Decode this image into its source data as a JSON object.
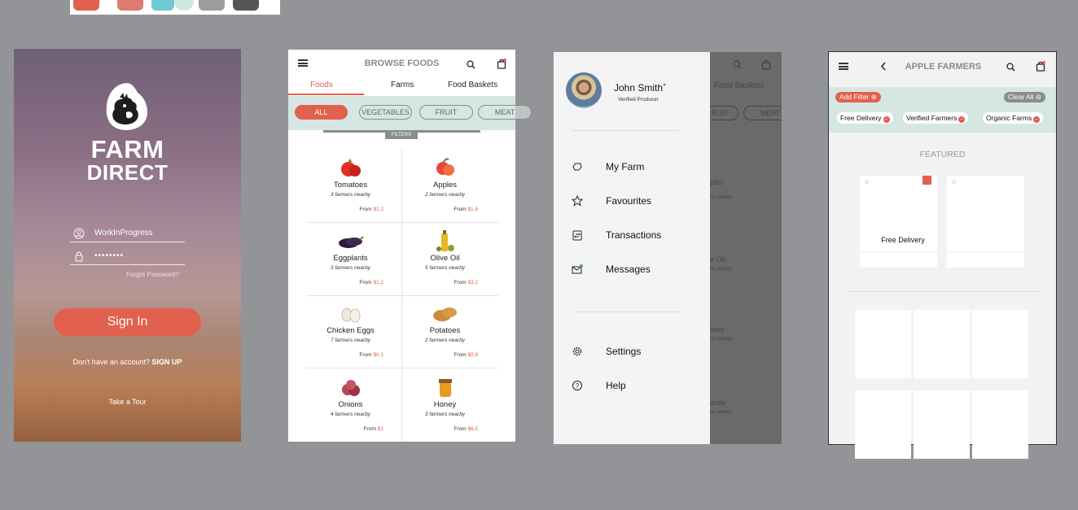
{
  "palette": {
    "colors": [
      "#e2604e",
      "#dd7b70",
      "#6fcad3",
      "#cde7e1",
      "#9c9c9c",
      "#565656"
    ]
  },
  "login": {
    "brand_line1": "FARM",
    "brand_line2": "DIRECT",
    "username_value": "WorkInProgress",
    "password_value": "••••••••",
    "forgot_label": "Forgot Password?",
    "signin_label": "Sign In",
    "no_account_text": "Don't have an account?",
    "signup_label": "SIGN UP",
    "tour_label": "Take a Tour"
  },
  "browse": {
    "title": "BROWSE FOODS",
    "cart_count": "",
    "tabs": [
      {
        "label": "Foods"
      },
      {
        "label": "Farms"
      },
      {
        "label": "Food Baskets"
      }
    ],
    "filters": [
      {
        "label": "ALL"
      },
      {
        "label": "VEGETABLES"
      },
      {
        "label": "FRUIT"
      },
      {
        "label": "MEAT"
      }
    ],
    "filters_label": "FILTERS",
    "from_label": "From",
    "foods": [
      {
        "name": "Tomatoes",
        "icon": "tomato-icon",
        "nearby": "3 farmers nearby",
        "price": "$1.2"
      },
      {
        "name": "Apples",
        "icon": "apple-icon",
        "nearby": "2 farmers nearby",
        "price": "$1.6"
      },
      {
        "name": "Eggplants",
        "icon": "eggplant-icon",
        "nearby": "3 farmers nearby",
        "price": "$1.2"
      },
      {
        "name": "Olive Oil",
        "icon": "olive-oil-icon",
        "nearby": "5 farmers nearby",
        "price": "$3.2"
      },
      {
        "name": "Chicken Eggs",
        "icon": "egg-icon",
        "nearby": "7 farmers nearby",
        "price": "$0.1"
      },
      {
        "name": "Potatoes",
        "icon": "potato-icon",
        "nearby": "2 farmers nearby",
        "price": "$0.9"
      },
      {
        "name": "Onions",
        "icon": "onion-icon",
        "nearby": "4 farmers nearby",
        "price": "$1"
      },
      {
        "name": "Honey",
        "icon": "honey-icon",
        "nearby": "3 farmers nearby",
        "price": "$6.5"
      }
    ]
  },
  "menu": {
    "user_name": "John Smith",
    "user_role": "Verified Producer",
    "items": [
      {
        "label": "My Farm",
        "icon": "farm-icon"
      },
      {
        "label": "Favourites",
        "icon": "star-icon"
      },
      {
        "label": "Transactions",
        "icon": "transactions-icon"
      },
      {
        "label": "Messages",
        "icon": "messages-icon"
      }
    ],
    "bottom_items": [
      {
        "label": "Settings",
        "icon": "gear-icon"
      },
      {
        "label": "Help",
        "icon": "help-icon"
      }
    ],
    "behind": {
      "tab": "Food Baskets",
      "filters": [
        "RUIT",
        "MEAT"
      ],
      "names": [
        "ples",
        "e Oil",
        "toes",
        "oney"
      ],
      "nearby": "rs nearby"
    }
  },
  "apple": {
    "title": "APPLE FARMERS",
    "add_filter_label": "Add Filter",
    "clear_all_label": "Clear All",
    "chips": [
      {
        "label": "Free Delivery"
      },
      {
        "label": "Verified Farmers"
      },
      {
        "label": "Organic Farms"
      }
    ],
    "featured_label": "FEATURED",
    "featured_cards": [
      {
        "label": "Free Delivery",
        "badge": true
      },
      {
        "label": "",
        "badge": false
      }
    ]
  }
}
